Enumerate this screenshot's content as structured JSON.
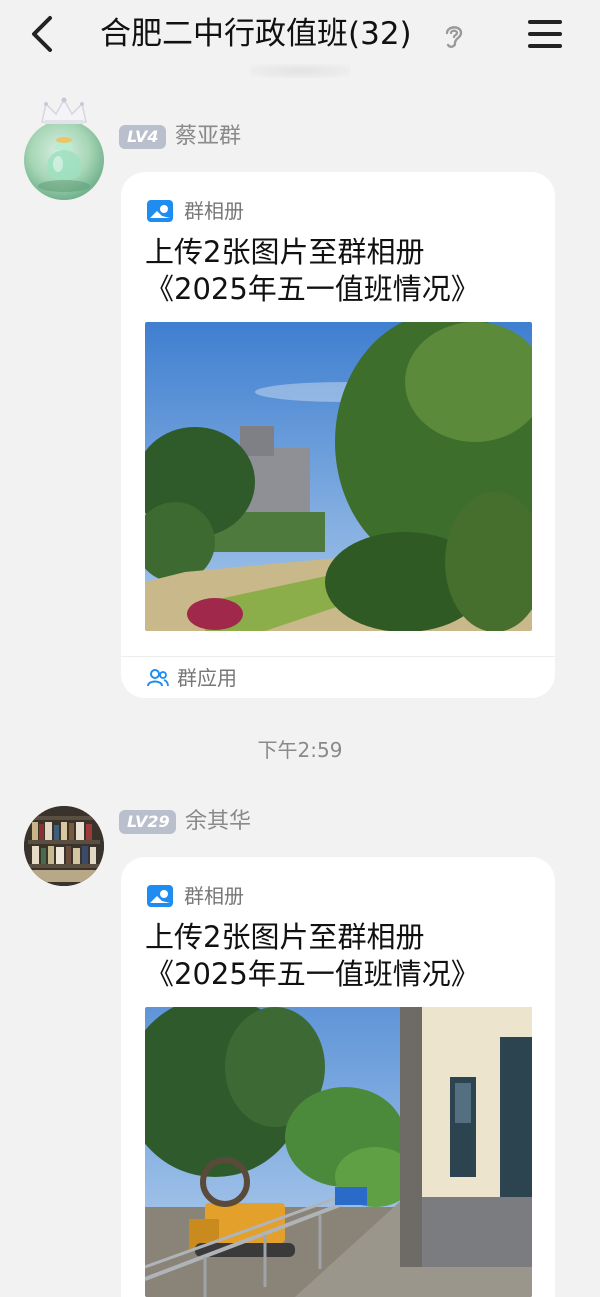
{
  "header": {
    "title": "合肥二中行政值班(32)",
    "back_icon": "chevron-left-icon",
    "ear_icon": "ear-icon",
    "menu_icon": "menu-icon"
  },
  "messages": [
    {
      "level": "LV4",
      "sender": "蔡亚群",
      "card": {
        "app_name": "群相册",
        "title_line1": "上传2张图片至群相册",
        "title_line2": "《2025年五一值班情况》",
        "footer_label": "群应用"
      }
    },
    {
      "level": "LV29",
      "sender": "余其华",
      "card": {
        "app_name": "群相册",
        "title_line1": "上传2张图片至群相册",
        "title_line2": "《2025年五一值班情况》"
      }
    }
  ],
  "timestamp": "下午2:59",
  "colors": {
    "background": "#f2f2f2",
    "card": "#ffffff",
    "accent_blue": "#1e8cf0",
    "muted_text": "#8a8a8a",
    "badge": "#b9bfcc"
  }
}
